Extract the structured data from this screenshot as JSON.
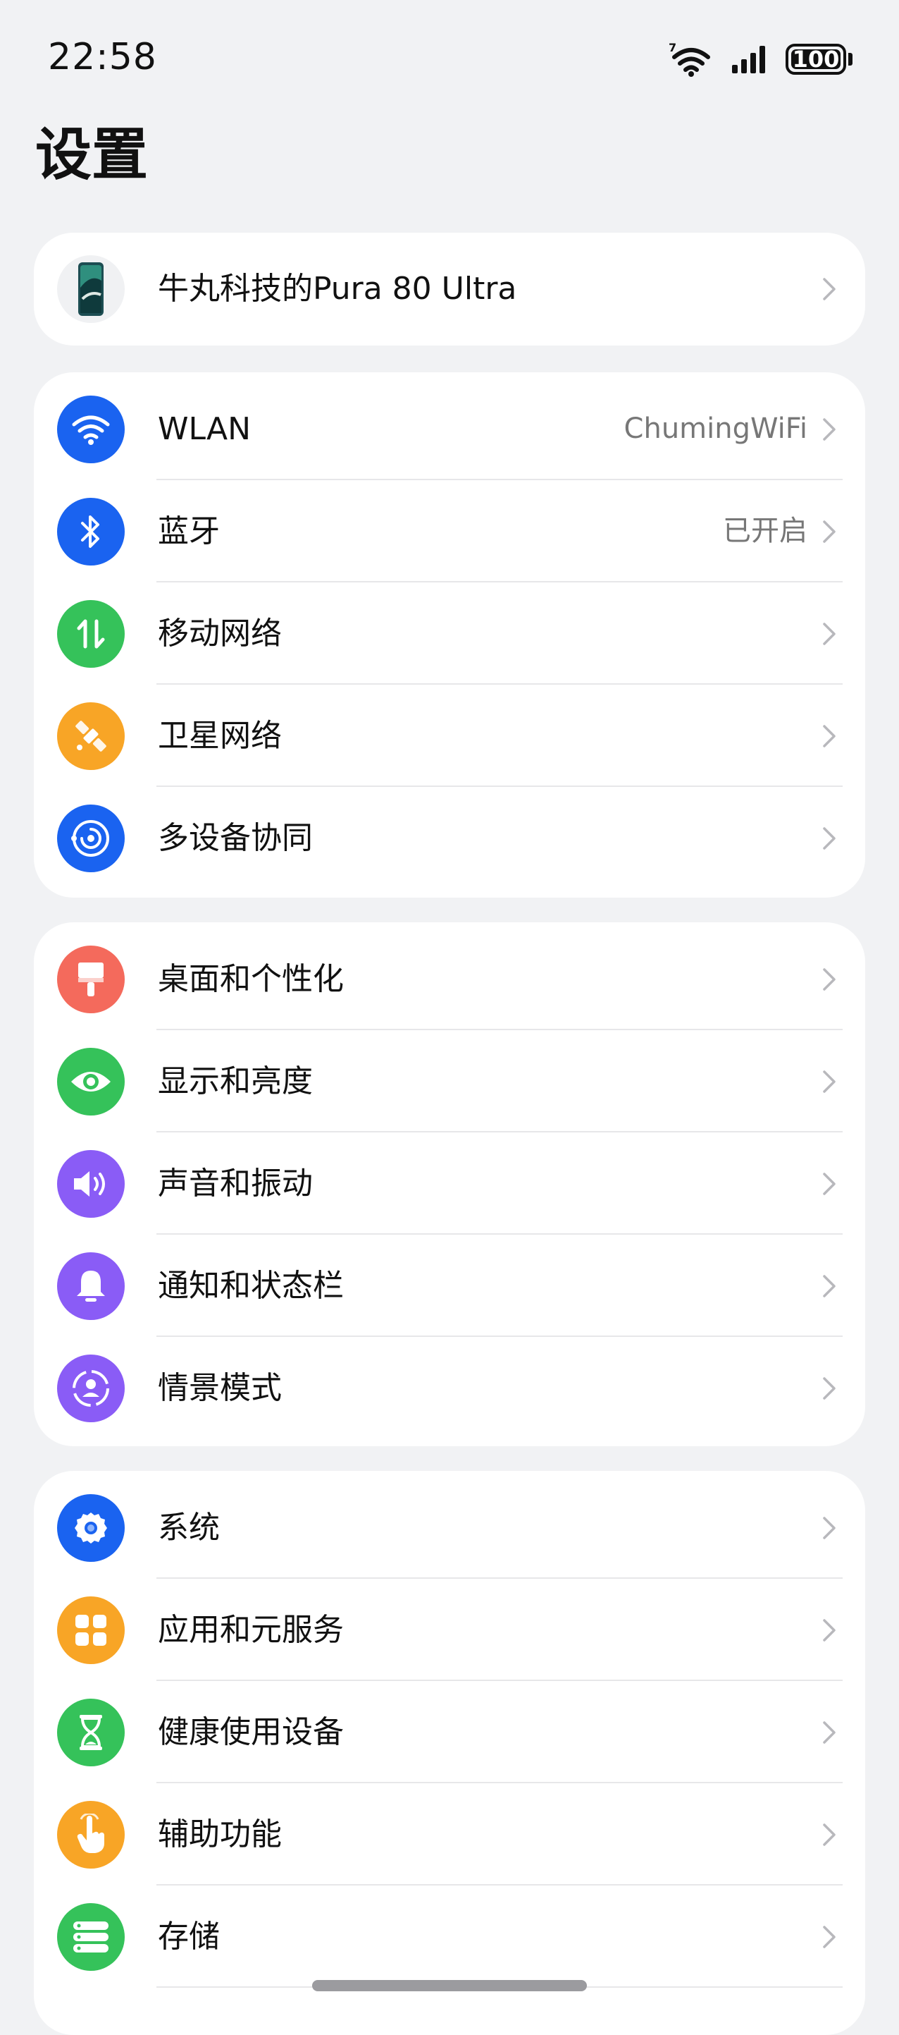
{
  "status_bar": {
    "time": "22:58",
    "wifi_badge": "7",
    "battery": "100"
  },
  "title": "设置",
  "device": {
    "name": "牛丸科技的Pura 80 Ultra",
    "icon": "phone-thumbnail"
  },
  "connectivity": [
    {
      "label": "WLAN",
      "value": "ChumingWiFi",
      "icon": "wifi-icon",
      "color": "#1a63f0"
    },
    {
      "label": "蓝牙",
      "value": "已开启",
      "icon": "bluetooth-icon",
      "color": "#1a63f0"
    },
    {
      "label": "移动网络",
      "value": "",
      "icon": "mobile-data-icon",
      "color": "#35c25a"
    },
    {
      "label": "卫星网络",
      "value": "",
      "icon": "satellite-icon",
      "color": "#f8a526"
    },
    {
      "label": "多设备协同",
      "value": "",
      "icon": "multi-device-icon",
      "color": "#1a63f0"
    }
  ],
  "personalization": [
    {
      "label": "桌面和个性化",
      "icon": "brush-icon",
      "color": "#f46a5c"
    },
    {
      "label": "显示和亮度",
      "icon": "eye-icon",
      "color": "#35c25a"
    },
    {
      "label": "声音和振动",
      "icon": "speaker-icon",
      "color": "#8a5cf6"
    },
    {
      "label": "通知和状态栏",
      "icon": "bell-icon",
      "color": "#8a5cf6"
    },
    {
      "label": "情景模式",
      "icon": "scene-mode-icon",
      "color": "#8a5cf6"
    }
  ],
  "system": [
    {
      "label": "系统",
      "icon": "gear-icon",
      "color": "#1a63f0"
    },
    {
      "label": "应用和元服务",
      "icon": "apps-grid-icon",
      "color": "#f8a526"
    },
    {
      "label": "健康使用设备",
      "icon": "hourglass-icon",
      "color": "#35c25a"
    },
    {
      "label": "辅助功能",
      "icon": "hand-pointer-icon",
      "color": "#f8a526"
    },
    {
      "label": "存储",
      "icon": "storage-icon",
      "color": "#35c25a"
    }
  ]
}
